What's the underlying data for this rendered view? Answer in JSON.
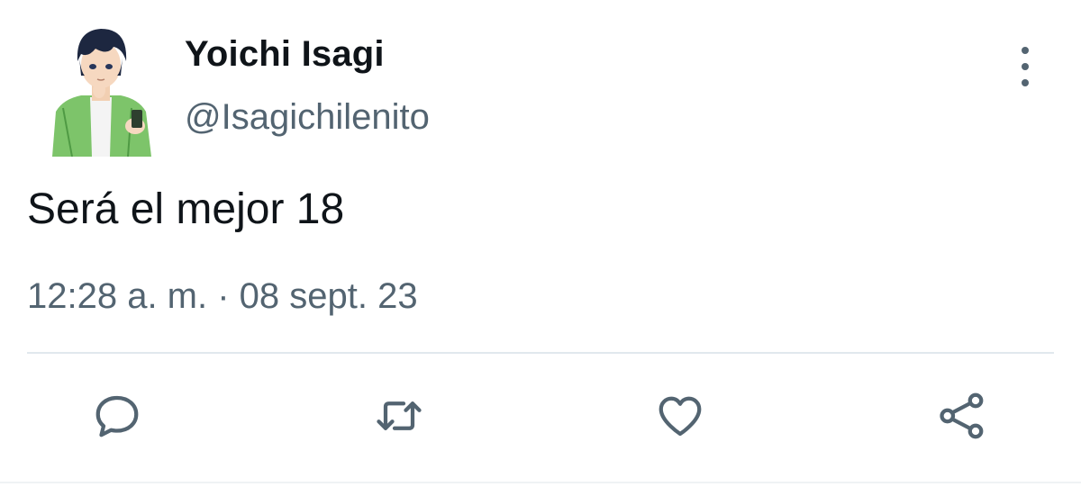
{
  "tweet": {
    "author": {
      "display_name": "Yoichi Isagi",
      "handle": "@Isagichilenito"
    },
    "text": "Será el mejor 18",
    "meta": "12:28 a. m. · 08 sept. 23"
  },
  "actions": [
    "reply",
    "retweet",
    "like",
    "share"
  ],
  "colors": {
    "text": "#0f1419",
    "secondary": "#536471",
    "divider": "#e1e8ed"
  }
}
